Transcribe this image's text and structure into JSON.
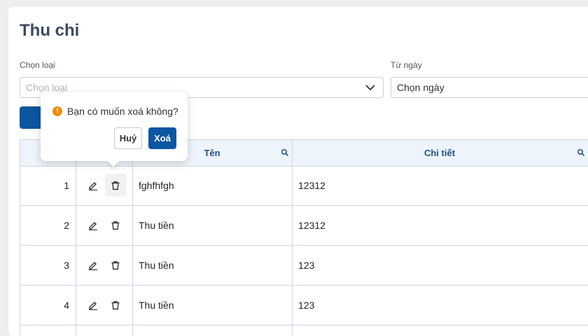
{
  "page": {
    "title": "Thu chi"
  },
  "filters": {
    "type_label": "Chọn loại",
    "type_placeholder": "Chọn loại",
    "date_label": "Từ ngày",
    "date_value": "Chọn ngày"
  },
  "table": {
    "columns": {
      "name": "Tên",
      "detail": "Chi tiết"
    },
    "rows": [
      {
        "stt": "1",
        "name": "fghfhfgh",
        "detail": "12312"
      },
      {
        "stt": "2",
        "name": "Thu tiền",
        "detail": "12312"
      },
      {
        "stt": "3",
        "name": "Thu tiền",
        "detail": "123"
      },
      {
        "stt": "4",
        "name": "Thu tiền",
        "detail": "123"
      }
    ]
  },
  "popconfirm": {
    "message": "Bạn có muốn xoá không?",
    "cancel_label": "Huỷ",
    "ok_label": "Xoá",
    "warning_glyph": "!"
  },
  "colors": {
    "primary": "#0b56a0",
    "warning": "#f08c0e",
    "header_bg": "#eef4fb",
    "header_text": "#1c4f86"
  },
  "icons": {
    "edit": "pencil-icon",
    "delete": "trash-icon",
    "search": "search-icon",
    "dropdown": "chevron-down-icon"
  }
}
